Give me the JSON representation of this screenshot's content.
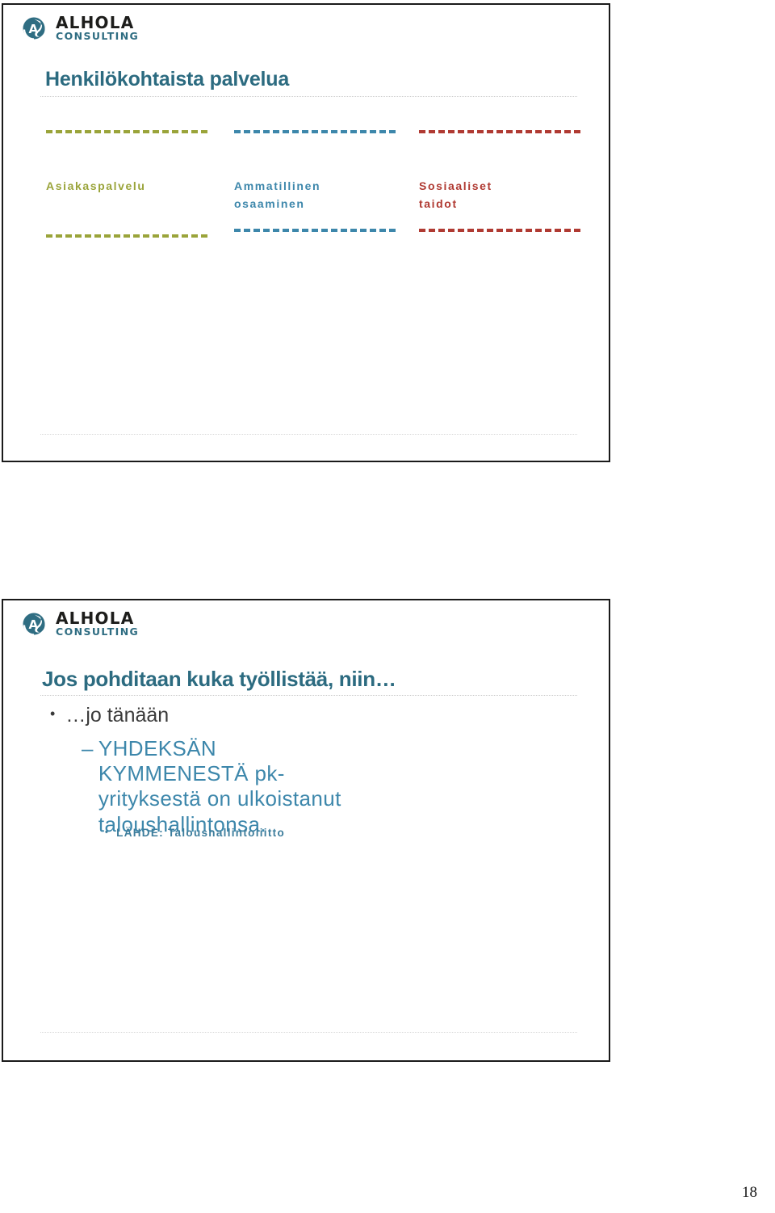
{
  "brand": {
    "logo_main": "ALHOLA",
    "logo_sub": "CONSULTING",
    "logo_mark_name": "alhola-circle-a-logo",
    "accent_teal": "#2c6b80",
    "accent_blue": "#3d87ab",
    "accent_olive": "#9aa43a",
    "accent_red": "#b03a32"
  },
  "slide_1": {
    "title": "Henkilökohtaista palvelua",
    "columns": [
      {
        "label": "Asiakaspalvelu",
        "color": "#9aa43a"
      },
      {
        "label": "Ammatillinen osaaminen",
        "color": "#3d87ab"
      },
      {
        "label": "Sosiaaliset taidot",
        "color": "#b03a32"
      }
    ]
  },
  "slide_2": {
    "title": "Jos pohditaan kuka työllistää, niin…",
    "bullet_level_1": "…jo tänään",
    "bullet_level_1_marker": "•",
    "bullet_level_2": "YHDEKSÄN KYMMENESTÄ pk-yrityksestä on ulkoistanut taloushallintonsa.",
    "bullet_level_2_marker": "–",
    "bullet_level_3": "LÄHDE: Taloushallintoliitto",
    "bullet_level_3_marker": "•"
  },
  "footer": {
    "page_number": "18"
  }
}
